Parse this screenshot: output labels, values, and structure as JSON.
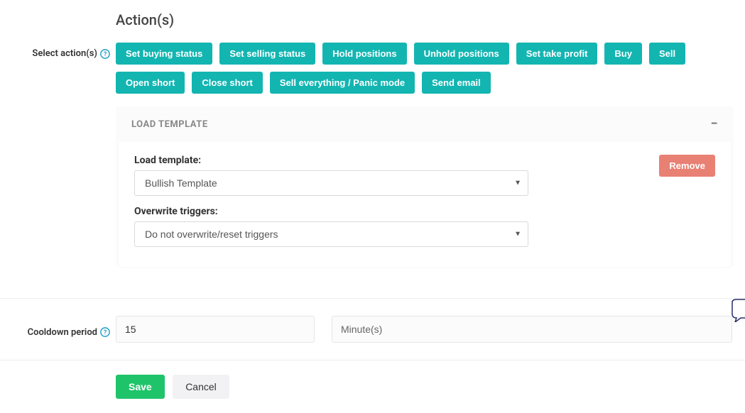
{
  "heading": "Action(s)",
  "labels": {
    "select_actions": "Select action(s)",
    "cooldown": "Cooldown period"
  },
  "actions": [
    "Set buying status",
    "Set selling status",
    "Hold positions",
    "Unhold positions",
    "Set take profit",
    "Buy",
    "Sell",
    "Open short",
    "Close short",
    "Sell everything / Panic mode",
    "Send email"
  ],
  "template_panel": {
    "header": "LOAD TEMPLATE",
    "load_template_label": "Load template:",
    "load_template_value": "Bullish Template",
    "overwrite_label": "Overwrite triggers:",
    "overwrite_value": "Do not overwrite/reset triggers",
    "remove_label": "Remove"
  },
  "cooldown": {
    "value": "15",
    "unit": "Minute(s)"
  },
  "footer": {
    "save": "Save",
    "cancel": "Cancel"
  }
}
